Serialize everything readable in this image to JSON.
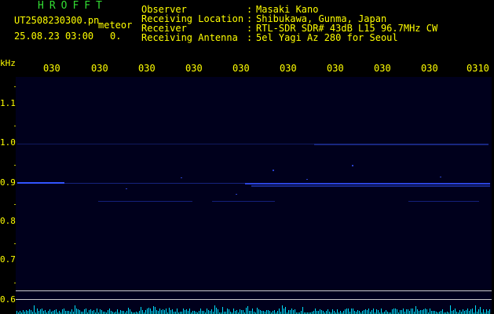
{
  "header": {
    "title": "HROFFT",
    "filename": "UT2508230300.pn",
    "mode": "meteor",
    "datetime": "25.08.23 03:00",
    "count": "0."
  },
  "info": [
    {
      "label": "Observer",
      "value": "Masaki Kano"
    },
    {
      "label": "Receiving Location",
      "value": "Shibukawa, Gunma, Japan"
    },
    {
      "label": "Receiver",
      "value": "RTL-SDR SDR# 43dB L15 96.7MHz CW"
    },
    {
      "label": "Receiving Antenna",
      "value": "5el Yagi Az 280 for Seoul"
    }
  ],
  "axis": {
    "y_unit": "kHz",
    "y_ticks": [
      "1.1",
      "1.0",
      "0.9",
      "0.8",
      "0.7",
      "0.6"
    ],
    "x_ticks": [
      "030",
      "030",
      "030",
      "030",
      "030",
      "030",
      "030",
      "030",
      "030",
      "0310"
    ]
  },
  "colors": {
    "background": "#000000",
    "text": "#ffff00",
    "title": "#33dd33",
    "signal": "#3355ff",
    "spectrum": "#00ddff"
  }
}
